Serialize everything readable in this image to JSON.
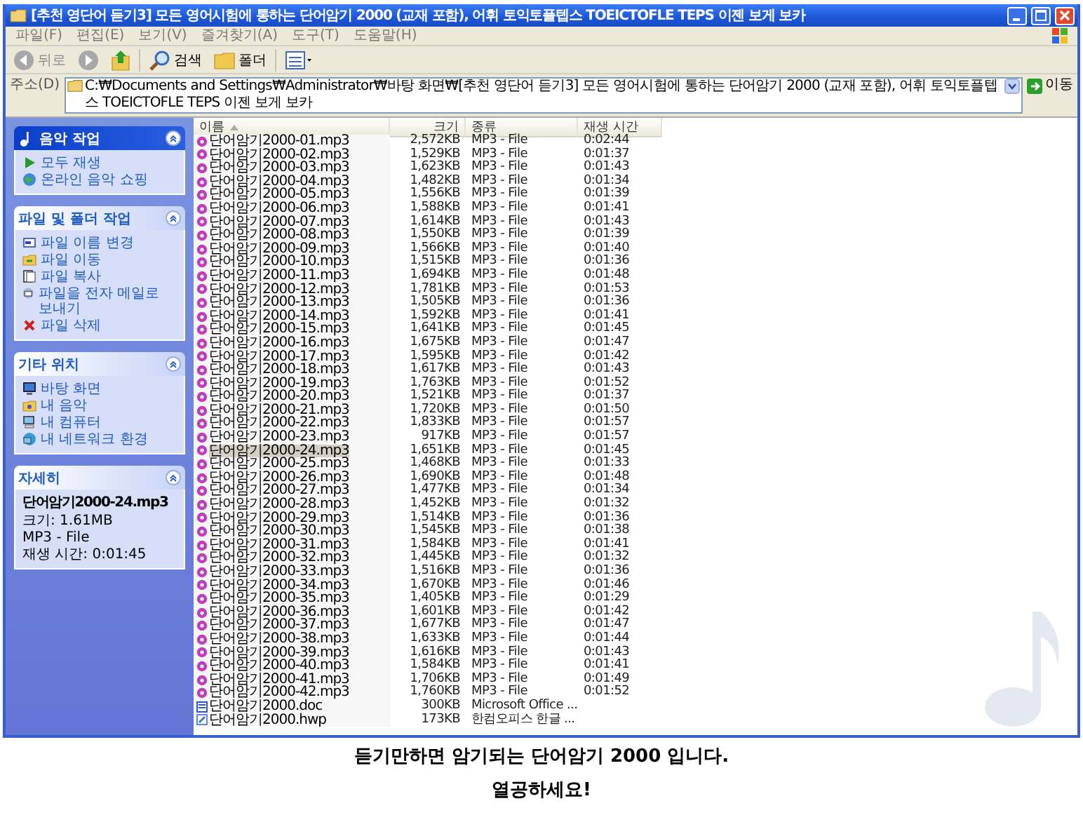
{
  "window": {
    "title": "[추천 영단어 듣기3] 모든 영어시험에 통하는 단어암기 2000 (교재 포함), 어휘 토익토플텝스 TOEICTOFLE TEPS 이젠 보게 보카"
  },
  "menu": [
    "파일(F)",
    "편집(E)",
    "보기(V)",
    "즐겨찾기(A)",
    "도구(T)",
    "도움말(H)"
  ],
  "toolbar": [
    {
      "kind": "back",
      "label": "뒤로"
    },
    {
      "kind": "forward"
    },
    {
      "kind": "up"
    },
    {
      "kind": "search",
      "label": "검색"
    },
    {
      "kind": "folders",
      "label": "폴더"
    },
    {
      "kind": "views"
    }
  ],
  "address": {
    "label": "주소(D)",
    "value": "C:₩Documents and Settings₩Administrator₩바탕 화면₩[추천 영단어 듣기3] 모든 영어시험에 통하는 단어암기 2000 (교재 포함), 어휘 토익토플텝스 TOEICTOFLE TEPS 이젠 보게 보카",
    "go": "이동"
  },
  "task_panels": [
    {
      "kind": "music",
      "title": "음악 작업",
      "items": [
        {
          "kind": "play",
          "label": "모두 재생"
        },
        {
          "kind": "globe",
          "label": "온라인 음악 쇼핑"
        }
      ]
    },
    {
      "kind": "plain",
      "title": "파일 및 폴더 작업",
      "items": [
        {
          "kind": "rename",
          "label": "파일 이름 변경"
        },
        {
          "kind": "move",
          "label": "파일 이동"
        },
        {
          "kind": "copy",
          "label": "파일 복사"
        },
        {
          "kind": "mail",
          "label": "파일을 전자 메일로 보내기"
        },
        {
          "kind": "delete",
          "label": "파일 삭제"
        }
      ]
    },
    {
      "kind": "plain",
      "title": "기타 위치",
      "items": [
        {
          "kind": "desktop",
          "label": "바탕 화면"
        },
        {
          "kind": "folder",
          "label": "내 음악"
        },
        {
          "kind": "computer",
          "label": "내 컴퓨터"
        },
        {
          "kind": "network",
          "label": "내 네트워크 환경"
        }
      ]
    }
  ],
  "details": {
    "title": "자세히",
    "file_name": "단어암기2000-24.mp3",
    "lines": [
      "크기: 1.61MB",
      "MP3 - File",
      "재생 시간: 0:01:45"
    ]
  },
  "table": {
    "columns": [
      "이름",
      "크기",
      "종류",
      "재생 시간"
    ],
    "rows": [
      {
        "kind": "mp3",
        "name": "단어암기2000-01.mp3",
        "size": "2,572KB",
        "type": "MP3 - File",
        "duration": "0:02:44",
        "selected": false
      },
      {
        "kind": "mp3",
        "name": "단어암기2000-02.mp3",
        "size": "1,529KB",
        "type": "MP3 - File",
        "duration": "0:01:37",
        "selected": false
      },
      {
        "kind": "mp3",
        "name": "단어암기2000-03.mp3",
        "size": "1,623KB",
        "type": "MP3 - File",
        "duration": "0:01:43",
        "selected": false
      },
      {
        "kind": "mp3",
        "name": "단어암기2000-04.mp3",
        "size": "1,482KB",
        "type": "MP3 - File",
        "duration": "0:01:34",
        "selected": false
      },
      {
        "kind": "mp3",
        "name": "단어암기2000-05.mp3",
        "size": "1,556KB",
        "type": "MP3 - File",
        "duration": "0:01:39",
        "selected": false
      },
      {
        "kind": "mp3",
        "name": "단어암기2000-06.mp3",
        "size": "1,588KB",
        "type": "MP3 - File",
        "duration": "0:01:41",
        "selected": false
      },
      {
        "kind": "mp3",
        "name": "단어암기2000-07.mp3",
        "size": "1,614KB",
        "type": "MP3 - File",
        "duration": "0:01:43",
        "selected": false
      },
      {
        "kind": "mp3",
        "name": "단어암기2000-08.mp3",
        "size": "1,550KB",
        "type": "MP3 - File",
        "duration": "0:01:39",
        "selected": false
      },
      {
        "kind": "mp3",
        "name": "단어암기2000-09.mp3",
        "size": "1,566KB",
        "type": "MP3 - File",
        "duration": "0:01:40",
        "selected": false
      },
      {
        "kind": "mp3",
        "name": "단어암기2000-10.mp3",
        "size": "1,515KB",
        "type": "MP3 - File",
        "duration": "0:01:36",
        "selected": false
      },
      {
        "kind": "mp3",
        "name": "단어암기2000-11.mp3",
        "size": "1,694KB",
        "type": "MP3 - File",
        "duration": "0:01:48",
        "selected": false
      },
      {
        "kind": "mp3",
        "name": "단어암기2000-12.mp3",
        "size": "1,781KB",
        "type": "MP3 - File",
        "duration": "0:01:53",
        "selected": false
      },
      {
        "kind": "mp3",
        "name": "단어암기2000-13.mp3",
        "size": "1,505KB",
        "type": "MP3 - File",
        "duration": "0:01:36",
        "selected": false
      },
      {
        "kind": "mp3",
        "name": "단어암기2000-14.mp3",
        "size": "1,592KB",
        "type": "MP3 - File",
        "duration": "0:01:41",
        "selected": false
      },
      {
        "kind": "mp3",
        "name": "단어암기2000-15.mp3",
        "size": "1,641KB",
        "type": "MP3 - File",
        "duration": "0:01:45",
        "selected": false
      },
      {
        "kind": "mp3",
        "name": "단어암기2000-16.mp3",
        "size": "1,675KB",
        "type": "MP3 - File",
        "duration": "0:01:47",
        "selected": false
      },
      {
        "kind": "mp3",
        "name": "단어암기2000-17.mp3",
        "size": "1,595KB",
        "type": "MP3 - File",
        "duration": "0:01:42",
        "selected": false
      },
      {
        "kind": "mp3",
        "name": "단어암기2000-18.mp3",
        "size": "1,617KB",
        "type": "MP3 - File",
        "duration": "0:01:43",
        "selected": false
      },
      {
        "kind": "mp3",
        "name": "단어암기2000-19.mp3",
        "size": "1,763KB",
        "type": "MP3 - File",
        "duration": "0:01:52",
        "selected": false
      },
      {
        "kind": "mp3",
        "name": "단어암기2000-20.mp3",
        "size": "1,521KB",
        "type": "MP3 - File",
        "duration": "0:01:37",
        "selected": false
      },
      {
        "kind": "mp3",
        "name": "단어암기2000-21.mp3",
        "size": "1,720KB",
        "type": "MP3 - File",
        "duration": "0:01:50",
        "selected": false
      },
      {
        "kind": "mp3",
        "name": "단어암기2000-22.mp3",
        "size": "1,833KB",
        "type": "MP3 - File",
        "duration": "0:01:57",
        "selected": false
      },
      {
        "kind": "mp3",
        "name": "단어암기2000-23.mp3",
        "size": "917KB",
        "type": "MP3 - File",
        "duration": "0:01:57",
        "selected": false
      },
      {
        "kind": "mp3",
        "name": "단어암기2000-24.mp3",
        "size": "1,651KB",
        "type": "MP3 - File",
        "duration": "0:01:45",
        "selected": true
      },
      {
        "kind": "mp3",
        "name": "단어암기2000-25.mp3",
        "size": "1,468KB",
        "type": "MP3 - File",
        "duration": "0:01:33",
        "selected": false
      },
      {
        "kind": "mp3",
        "name": "단어암기2000-26.mp3",
        "size": "1,690KB",
        "type": "MP3 - File",
        "duration": "0:01:48",
        "selected": false
      },
      {
        "kind": "mp3",
        "name": "단어암기2000-27.mp3",
        "size": "1,477KB",
        "type": "MP3 - File",
        "duration": "0:01:34",
        "selected": false
      },
      {
        "kind": "mp3",
        "name": "단어암기2000-28.mp3",
        "size": "1,452KB",
        "type": "MP3 - File",
        "duration": "0:01:32",
        "selected": false
      },
      {
        "kind": "mp3",
        "name": "단어암기2000-29.mp3",
        "size": "1,514KB",
        "type": "MP3 - File",
        "duration": "0:01:36",
        "selected": false
      },
      {
        "kind": "mp3",
        "name": "단어암기2000-30.mp3",
        "size": "1,545KB",
        "type": "MP3 - File",
        "duration": "0:01:38",
        "selected": false
      },
      {
        "kind": "mp3",
        "name": "단어암기2000-31.mp3",
        "size": "1,584KB",
        "type": "MP3 - File",
        "duration": "0:01:41",
        "selected": false
      },
      {
        "kind": "mp3",
        "name": "단어암기2000-32.mp3",
        "size": "1,445KB",
        "type": "MP3 - File",
        "duration": "0:01:32",
        "selected": false
      },
      {
        "kind": "mp3",
        "name": "단어암기2000-33.mp3",
        "size": "1,516KB",
        "type": "MP3 - File",
        "duration": "0:01:36",
        "selected": false
      },
      {
        "kind": "mp3",
        "name": "단어암기2000-34.mp3",
        "size": "1,670KB",
        "type": "MP3 - File",
        "duration": "0:01:46",
        "selected": false
      },
      {
        "kind": "mp3",
        "name": "단어암기2000-35.mp3",
        "size": "1,405KB",
        "type": "MP3 - File",
        "duration": "0:01:29",
        "selected": false
      },
      {
        "kind": "mp3",
        "name": "단어암기2000-36.mp3",
        "size": "1,601KB",
        "type": "MP3 - File",
        "duration": "0:01:42",
        "selected": false
      },
      {
        "kind": "mp3",
        "name": "단어암기2000-37.mp3",
        "size": "1,677KB",
        "type": "MP3 - File",
        "duration": "0:01:47",
        "selected": false
      },
      {
        "kind": "mp3",
        "name": "단어암기2000-38.mp3",
        "size": "1,633KB",
        "type": "MP3 - File",
        "duration": "0:01:44",
        "selected": false
      },
      {
        "kind": "mp3",
        "name": "단어암기2000-39.mp3",
        "size": "1,616KB",
        "type": "MP3 - File",
        "duration": "0:01:43",
        "selected": false
      },
      {
        "kind": "mp3",
        "name": "단어암기2000-40.mp3",
        "size": "1,584KB",
        "type": "MP3 - File",
        "duration": "0:01:41",
        "selected": false
      },
      {
        "kind": "mp3",
        "name": "단어암기2000-41.mp3",
        "size": "1,706KB",
        "type": "MP3 - File",
        "duration": "0:01:49",
        "selected": false
      },
      {
        "kind": "mp3",
        "name": "단어암기2000-42.mp3",
        "size": "1,760KB",
        "type": "MP3 - File",
        "duration": "0:01:52",
        "selected": false
      },
      {
        "kind": "doc",
        "name": "단어암기2000.doc",
        "size": "300KB",
        "type": "Microsoft Office ...",
        "selected": false
      },
      {
        "kind": "hwp",
        "name": "단어암기2000.hwp",
        "size": "173KB",
        "type": "한컴오피스 한글 ...",
        "selected": false
      }
    ]
  },
  "caption": [
    "듣기만하면 암기되는 단어암기 2000 입니다.",
    "열공하세요!"
  ]
}
